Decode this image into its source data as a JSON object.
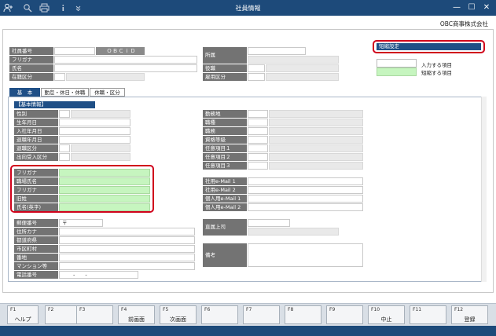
{
  "window": {
    "title": "社員情報",
    "company": "OBC商事株式会社"
  },
  "toolbar": {
    "icons": [
      "user-plus-icon",
      "search-icon",
      "print-icon",
      "info-icon",
      "dropdown-icon"
    ]
  },
  "window_controls": {
    "minimize": "—",
    "maximize": "☐",
    "close": "✕"
  },
  "header": {
    "employee_no_label": "社員番号",
    "employee_no_value": "ＯＢＣｉＤ",
    "furigana_label": "フリガナ",
    "name_label": "氏名",
    "status_label": "在籍区分",
    "dept_label": "所属",
    "position_label": "役職",
    "employment_label": "雇用区分"
  },
  "short_setting": {
    "label": "短縮設定"
  },
  "legend": {
    "input_label": "入力する項目",
    "short_label": "短縮する項目"
  },
  "tabs": [
    "基　本",
    "勤怠・休日・休職",
    "休職・区分"
  ],
  "basic": {
    "section_title": "【基本情報】",
    "left_labels": [
      "性別",
      "生年月日",
      "入社年月日",
      "退職年月日",
      "退職区分",
      "出向受入区分"
    ],
    "right_labels": [
      "勤務地",
      "職種",
      "職務",
      "資格等級",
      "任意項目１",
      "任意項目２",
      "任意項目３"
    ]
  },
  "names": {
    "labels": [
      "フリガナ",
      "職場氏名",
      "フリガナ",
      "旧姓",
      "氏名(英字)"
    ]
  },
  "emails": {
    "labels": [
      "社用e-Mail 1",
      "社用e-Mail 2",
      "個人用e-Mail 1",
      "個人用e-Mail 2"
    ]
  },
  "address": {
    "labels": [
      "郵便番号",
      "住所カナ",
      "都道府県",
      "市区町村",
      "番地",
      "マンション等",
      "電話番号"
    ],
    "postal_mark": "〒",
    "phone_value": "-　　-"
  },
  "boss": {
    "label": "直属上司"
  },
  "memo": {
    "label": "備考"
  },
  "fkeys": [
    {
      "num": "F1",
      "label": "ヘルプ"
    },
    {
      "num": "F2",
      "label": ""
    },
    {
      "num": "F3",
      "label": ""
    },
    {
      "num": "F4",
      "label": "前画面"
    },
    {
      "num": "F5",
      "label": "次画面"
    },
    {
      "num": "F6",
      "label": ""
    },
    {
      "num": "F7",
      "label": ""
    },
    {
      "num": "F8",
      "label": ""
    },
    {
      "num": "F9",
      "label": ""
    },
    {
      "num": "F10",
      "label": "中止"
    },
    {
      "num": "F11",
      "label": ""
    },
    {
      "num": "F12",
      "label": "登録"
    }
  ],
  "colors": {
    "title_bar": "#1d4a7a",
    "label_bg": "#737373",
    "short_green": "#c6f5bf",
    "highlight_red": "#d0021b",
    "tab_active": "#1f4f86"
  }
}
